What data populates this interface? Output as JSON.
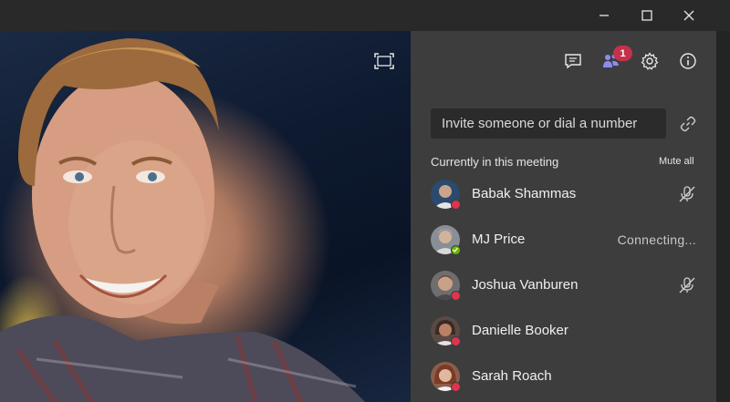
{
  "window": {
    "controls": [
      {
        "name": "minimize-button",
        "icon": "minimize-icon"
      },
      {
        "name": "maximize-button",
        "icon": "maximize-icon"
      },
      {
        "name": "close-button",
        "icon": "close-icon"
      }
    ]
  },
  "video": {
    "fullscreen_icon": "fullscreen-icon"
  },
  "panel": {
    "toolbar": {
      "chat_icon": "chat-icon",
      "participants_icon": "participants-icon",
      "participants_badge": "1",
      "settings_icon": "gear-icon",
      "info_icon": "info-icon"
    },
    "invite": {
      "placeholder": "Invite someone or dial a number",
      "value": ""
    },
    "section_label": "Currently in this meeting",
    "mute_all_label": "Mute all",
    "participants": [
      {
        "name": "Babak Shammas",
        "status": "busy",
        "status_color": "#e0334f",
        "state": "muted",
        "avatar_colors": [
          "#c9a48b",
          "#2b4a6e"
        ]
      },
      {
        "name": "MJ Price",
        "status": "available",
        "status_color": "#6bb700",
        "state": "Connecting...",
        "avatar_colors": [
          "#d2b49a",
          "#8a8f96"
        ]
      },
      {
        "name": "Joshua Vanburen",
        "status": "busy",
        "status_color": "#e0334f",
        "state": "muted",
        "avatar_colors": [
          "#caa088",
          "#6b4a35"
        ]
      },
      {
        "name": "Danielle Booker",
        "status": "busy",
        "status_color": "#e0334f",
        "state": "",
        "avatar_colors": [
          "#b98066",
          "#3b2a24"
        ]
      },
      {
        "name": "Sarah Roach",
        "status": "busy",
        "status_color": "#e0334f",
        "state": "",
        "avatar_colors": [
          "#e0b8a0",
          "#7a3b24"
        ]
      }
    ]
  }
}
